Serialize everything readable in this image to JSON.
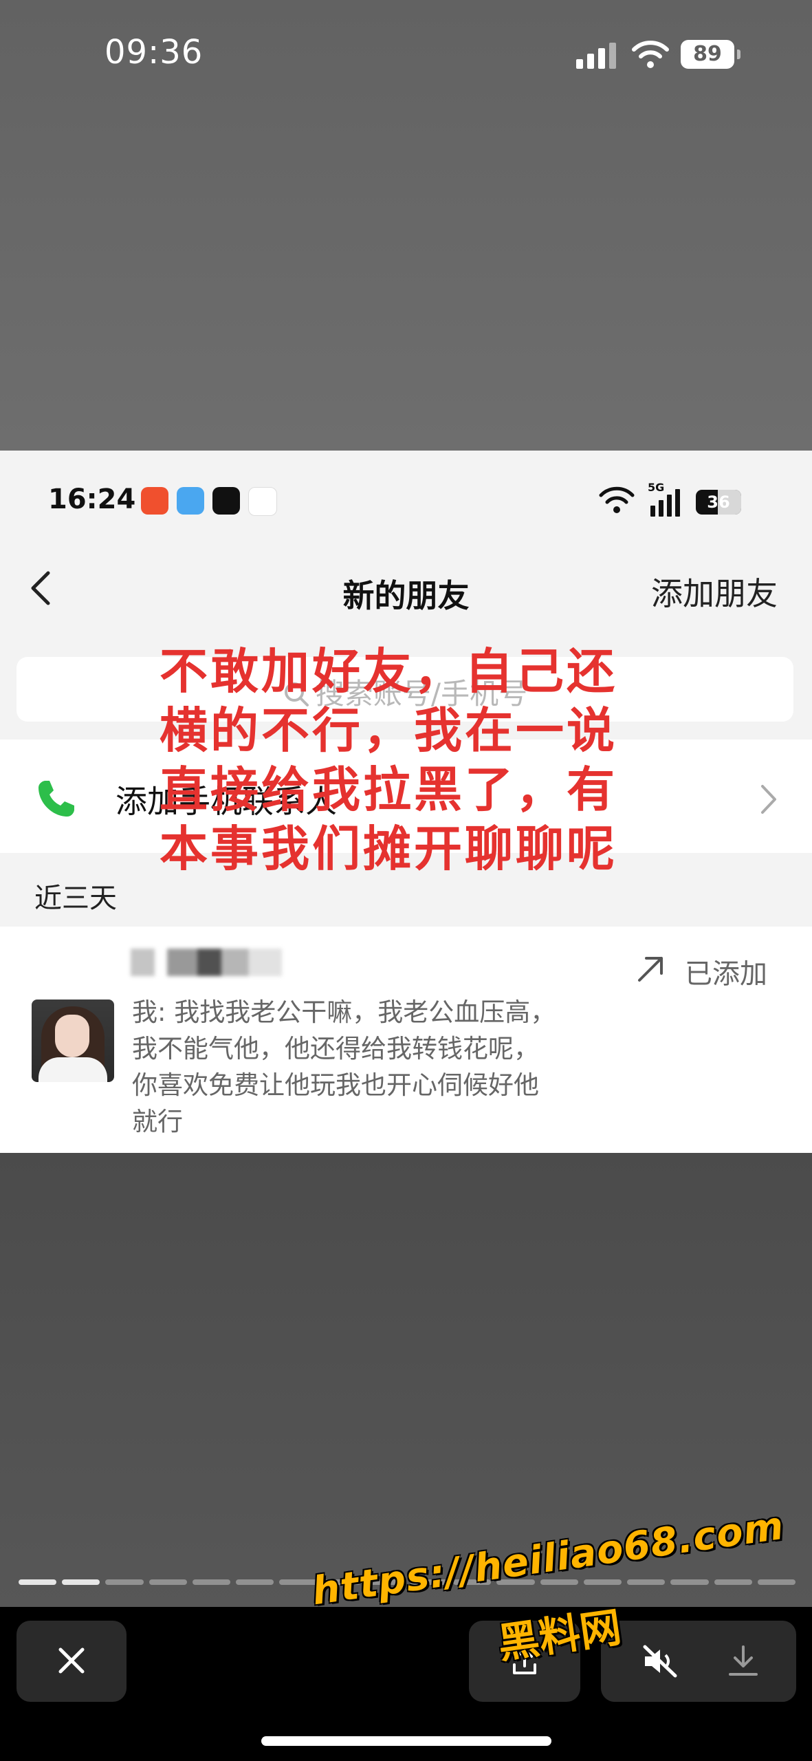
{
  "outer_status": {
    "time": "09:36",
    "battery": "89"
  },
  "inner_status": {
    "time": "16:24",
    "network": "5G",
    "battery": "36"
  },
  "nav": {
    "title": "新的朋友",
    "add_friend": "添加朋友"
  },
  "search": {
    "placeholder": "搜索账号/手机号"
  },
  "phone_contacts": {
    "label": "添加手机联系人"
  },
  "section": {
    "label": "近三天"
  },
  "friend": {
    "status": "已添加",
    "message_lines": [
      "我: 我找我老公干嘛，我老公血压高，",
      "我不能气他，他还得给我转钱花呢，",
      "你喜欢免费让他玩我也开心伺候好他",
      "就行"
    ]
  },
  "overlay_caption": {
    "lines": [
      "不敢加好友，自己还",
      "横的不行，我在一说",
      "直接给我拉黑了，有",
      "本事我们摊开聊聊呢"
    ]
  },
  "story_progress": {
    "segments": 18,
    "viewed": 2
  },
  "watermark": {
    "url": "https://heiliao68.com",
    "name": "黑料网"
  },
  "colors": {
    "caption": "#e5322f",
    "phone_icon": "#2dbe4a",
    "watermark": "#ffb400"
  }
}
